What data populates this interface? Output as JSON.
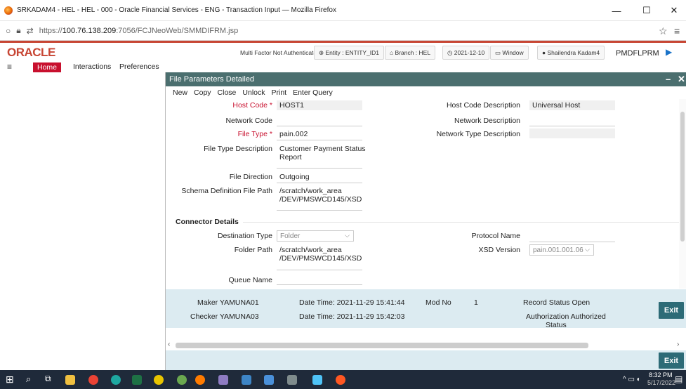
{
  "browser": {
    "window_title": "SRKADAM4 - HEL - HEL - 000 - Oracle Financial Services - ENG - Transaction Input — Mozilla Firefox",
    "url_prefix": "https://",
    "url_host": "100.76.138.209",
    "url_rest": ":7056/FCJNeoWeb/SMMDIFRM.jsp",
    "minimize": "—",
    "maximize": "☐",
    "close": "✕",
    "star": "☆",
    "menu": "≡"
  },
  "header": {
    "logo": "ORACLE",
    "mfa": "Multi Factor Not Authenticated",
    "entity": "Entity : ENTITY_ID1",
    "branch": "Branch : HEL",
    "date": "2021-12-10",
    "window": "Window",
    "user": "Shailendra Kadam4",
    "env": "PMDFLPRM"
  },
  "menu": {
    "home": "Home",
    "interactions": "Interactions",
    "preferences": "Preferences"
  },
  "screen": {
    "title": "File Parameters Detailed",
    "toolbar": [
      "New",
      "Copy",
      "Close",
      "Unlock",
      "Print",
      "Enter Query"
    ],
    "fields": {
      "host_code_label": "Host Code",
      "host_code": "HOST1",
      "host_code_desc_label": "Host Code Description",
      "host_code_desc": "Universal Host",
      "network_code_label": "Network Code",
      "network_code": "",
      "network_desc_label": "Network Description",
      "network_desc": "",
      "file_type_label": "File Type",
      "file_type": "pain.002",
      "network_type_desc_label": "Network Type Description",
      "network_type_desc": "",
      "file_type_desc_label": "File Type Description",
      "file_type_desc_1": "Customer Payment Status",
      "file_type_desc_2": "Report",
      "file_direction_label": "File Direction",
      "file_direction": "Outgoing",
      "schema_label": "Schema Definition File Path",
      "schema_1": "/scratch/work_area",
      "schema_2": "/DEV/PMSWCD145/XSD"
    },
    "connector": {
      "section_title": "Connector Details",
      "destination_type_label": "Destination Type",
      "destination_type": "Folder",
      "protocol_name_label": "Protocol Name",
      "protocol_name": "",
      "folder_path_label": "Folder Path",
      "folder_path_1": "/scratch/work_area",
      "folder_path_2": "/DEV/PMSWCD145/XSD",
      "xsd_version_label": "XSD Version",
      "xsd_version": "pain.001.001.06",
      "queue_name_label": "Queue Name",
      "queue_name": ""
    },
    "audit": {
      "maker": "Maker YAMUNA01",
      "maker_dt": "Date Time: 2021-11-29 15:41:44",
      "mod_no_label": "Mod No",
      "mod_no": "1",
      "record_status": "Record Status Open",
      "checker": "Checker YAMUNA03",
      "checker_dt": "Date Time: 2021-11-29 15:42:03",
      "auth_status_1": "Authorization Authorized",
      "auth_status_2": "Status"
    },
    "exit": "Exit"
  },
  "taskbar": {
    "time": "8:32 PM",
    "date": "5/17/2022"
  }
}
